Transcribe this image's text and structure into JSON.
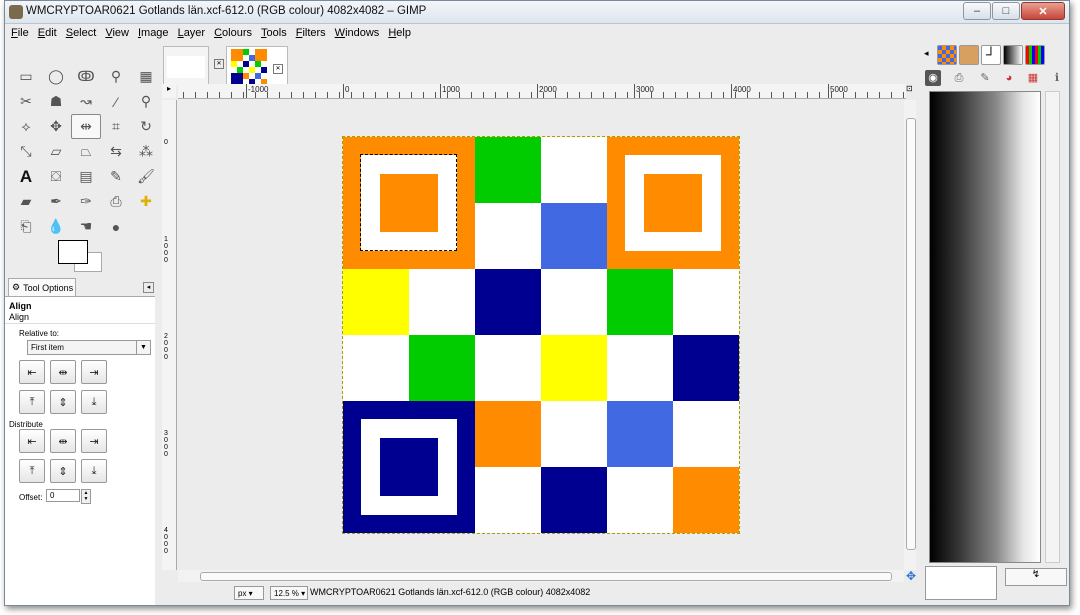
{
  "window": {
    "title": "WMCRYPTOAR0621 Gotlands län.xcf-612.0 (RGB colour) 4082x4082 – GIMP",
    "minimize": "–",
    "maximize": "□",
    "close": "✕"
  },
  "menubar": [
    "File",
    "Edit",
    "Select",
    "View",
    "Image",
    "Layer",
    "Colours",
    "Tools",
    "Filters",
    "Windows",
    "Help"
  ],
  "toolbox": {
    "tools": [
      {
        "name": "rect-select-icon",
        "glyph": "▭"
      },
      {
        "name": "ellipse-select-icon",
        "glyph": "◯"
      },
      {
        "name": "free-select-icon",
        "glyph": "ↂ"
      },
      {
        "name": "fuzzy-select-icon",
        "glyph": "⚲"
      },
      {
        "name": "select-by-color-icon",
        "glyph": "▦"
      },
      {
        "name": "scissors-icon",
        "glyph": "✂"
      },
      {
        "name": "foreground-select-icon",
        "glyph": "☗"
      },
      {
        "name": "paths-icon",
        "glyph": "↝"
      },
      {
        "name": "color-picker-icon",
        "glyph": "⁄"
      },
      {
        "name": "zoom-icon",
        "glyph": "⚲"
      },
      {
        "name": "measure-icon",
        "glyph": "⟡"
      },
      {
        "name": "move-icon",
        "glyph": "✥"
      },
      {
        "name": "align-icon",
        "glyph": "⇹"
      },
      {
        "name": "crop-icon",
        "glyph": "⌗"
      },
      {
        "name": "rotate-icon",
        "glyph": "↻"
      },
      {
        "name": "scale-icon",
        "glyph": "⤡"
      },
      {
        "name": "shear-icon",
        "glyph": "▱"
      },
      {
        "name": "perspective-icon",
        "glyph": "⏢"
      },
      {
        "name": "flip-icon",
        "glyph": "⇆"
      },
      {
        "name": "cage-icon",
        "glyph": "⁂"
      },
      {
        "name": "text-icon",
        "glyph": "A"
      },
      {
        "name": "bucket-fill-icon",
        "glyph": "⛋"
      },
      {
        "name": "blend-icon",
        "glyph": "▤"
      },
      {
        "name": "pencil-icon",
        "glyph": "✎"
      },
      {
        "name": "paintbrush-icon",
        "glyph": "🖌"
      },
      {
        "name": "eraser-icon",
        "glyph": "▰"
      },
      {
        "name": "airbrush-icon",
        "glyph": "✒"
      },
      {
        "name": "ink-icon",
        "glyph": "✑"
      },
      {
        "name": "clone-icon",
        "glyph": "⎙"
      },
      {
        "name": "heal-icon",
        "glyph": "✚"
      },
      {
        "name": "perspective-clone-icon",
        "glyph": "⎗"
      },
      {
        "name": "blur-icon",
        "glyph": "💧"
      },
      {
        "name": "smudge-icon",
        "glyph": "☚"
      },
      {
        "name": "dodge-burn-icon",
        "glyph": "●"
      }
    ],
    "options": {
      "tab_label": "Tool Options",
      "header": "Align",
      "subheader": "Align",
      "relative_label": "Relative to:",
      "relative_value": "First item",
      "distribute_label": "Distribute",
      "offset_label": "Offset:",
      "offset_value": "0"
    }
  },
  "image_window": {
    "ruler_labels": [
      "-1000",
      "0",
      "1000",
      "2000",
      "3000",
      "4000",
      "5000"
    ],
    "vertical_ruler_labels": [
      "0",
      "1000",
      "2000",
      "3000",
      "4000"
    ],
    "unit": "px",
    "zoom": "12.5 %",
    "status": "WMCRYPTOAR0621 Gotlands län.xcf-612.0 (RGB colour) 4082x4082"
  },
  "artwork": {
    "colors": {
      "orange": "#ff8c00",
      "green": "#00cc00",
      "white": "#ffffff",
      "blue": "#4169e1",
      "navy": "#000090",
      "yellow": "#ffff00"
    },
    "grid": [
      [
        "orange",
        "orange",
        "green",
        "white",
        "orange",
        "orange"
      ],
      [
        "orange",
        "orange",
        "white",
        "blue",
        "orange",
        "orange"
      ],
      [
        "yellow",
        "white",
        "navy",
        "white",
        "green",
        "white"
      ],
      [
        "white",
        "green",
        "white",
        "yellow",
        "white",
        "navy"
      ],
      [
        "navy",
        "navy",
        "orange",
        "white",
        "blue",
        "white"
      ],
      [
        "navy",
        "navy",
        "white",
        "navy",
        "white",
        "orange"
      ]
    ],
    "finders": [
      {
        "row": 0,
        "col": 0,
        "color": "orange"
      },
      {
        "row": 0,
        "col": 4,
        "color": "orange"
      },
      {
        "row": 4,
        "col": 0,
        "color": "navy"
      }
    ]
  },
  "dock": {
    "bottom_button": "↯"
  }
}
